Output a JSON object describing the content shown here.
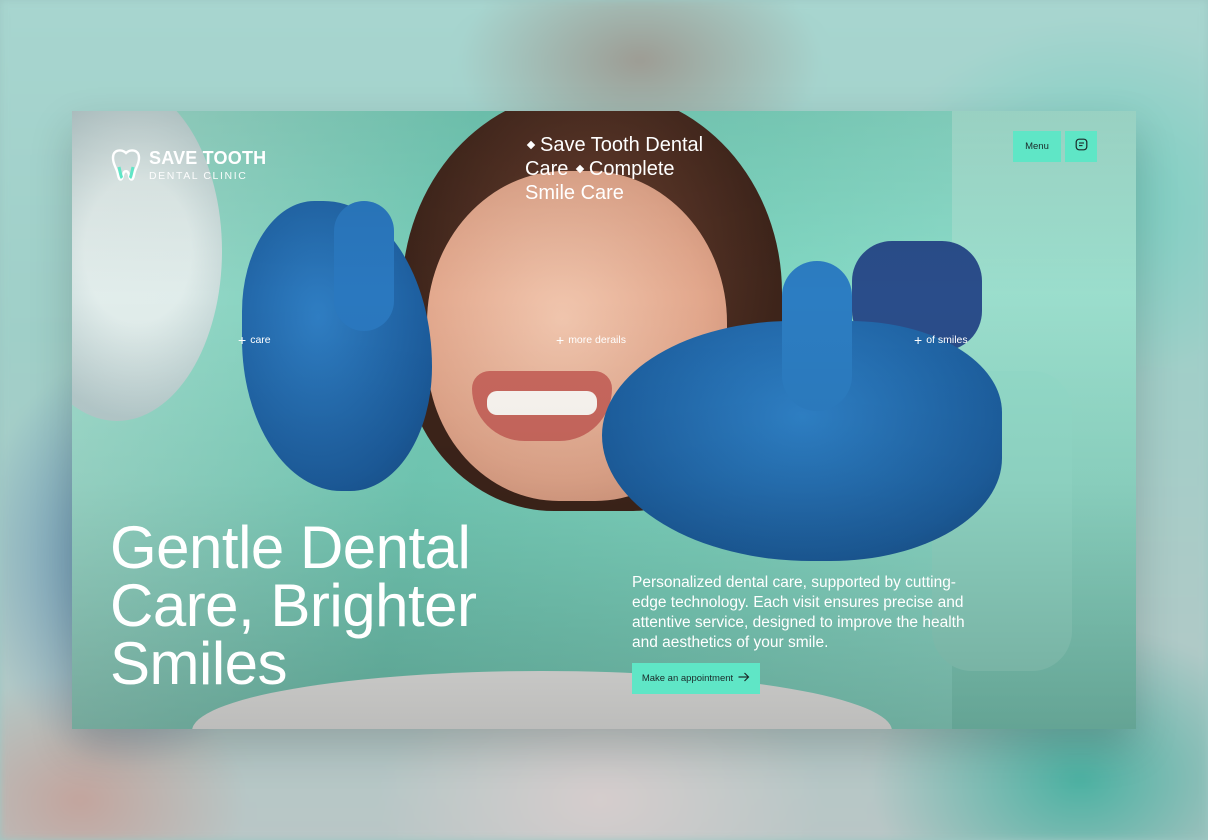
{
  "brand": {
    "name": "SAVE TOOTH",
    "subtitle": "DENTAL CLINIC"
  },
  "tagline": {
    "parts": [
      "Save Tooth Dental Care",
      "Complete Smile Care"
    ]
  },
  "nav": {
    "menu_label": "Menu",
    "chat_icon": "chat-icon"
  },
  "hotspots": [
    {
      "label": "care"
    },
    {
      "label": "more derails"
    },
    {
      "label": "of smiles"
    }
  ],
  "hero": {
    "headline": "Gentle Dental Care, Brighter Smiles",
    "description": "Personalized dental care, supported by cutting-edge technology. Each visit ensures precise and attentive service, designed to improve the health and aesthetics of your smile.",
    "cta_label": "Make an appointment",
    "cta_icon": "arrow-right-icon"
  },
  "colors": {
    "accent": "#5fe6c6",
    "text_on_accent": "#1b2a2a",
    "text": "#ffffff"
  }
}
